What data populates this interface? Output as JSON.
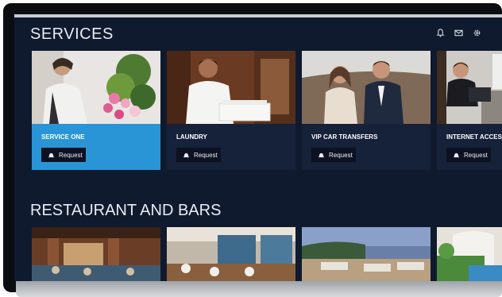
{
  "header": {
    "title": "SERVICES",
    "icons": [
      "bell-icon",
      "mail-icon",
      "gear-icon"
    ]
  },
  "services": [
    {
      "label": "SERVICE ONE",
      "button": "Request",
      "active": true
    },
    {
      "label": "LAUNDRY",
      "button": "Request",
      "active": false
    },
    {
      "label": "VIP CAR TRANSFERS",
      "button": "Request",
      "active": false
    },
    {
      "label": "INTERNET ACCESS",
      "button": "Request",
      "active": false
    }
  ],
  "restaurants": {
    "title": "RESTAURANT AND BARS"
  },
  "colors": {
    "background": "#101a2e",
    "card": "#16213a",
    "accent": "#2a95d6",
    "button": "#0c1222"
  }
}
